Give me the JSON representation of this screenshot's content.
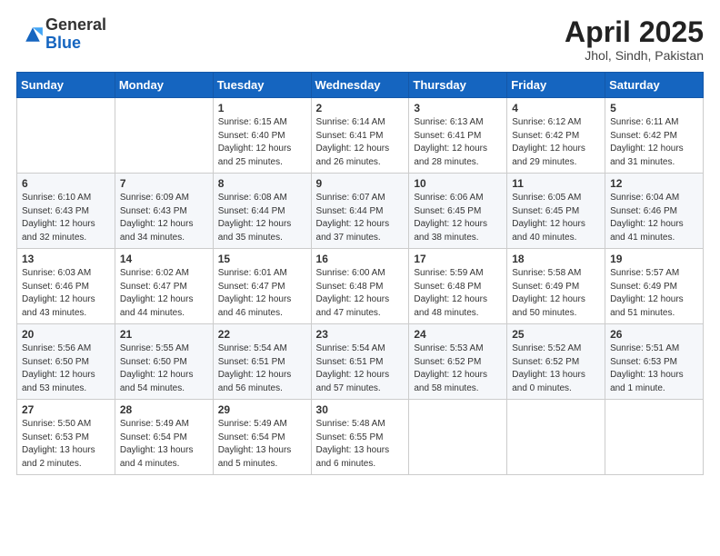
{
  "header": {
    "logo": {
      "line1": "General",
      "line2": "Blue"
    },
    "title": "April 2025",
    "subtitle": "Jhol, Sindh, Pakistan"
  },
  "weekdays": [
    "Sunday",
    "Monday",
    "Tuesday",
    "Wednesday",
    "Thursday",
    "Friday",
    "Saturday"
  ],
  "weeks": [
    [
      {
        "day": null
      },
      {
        "day": null
      },
      {
        "day": "1",
        "sunrise": "6:15 AM",
        "sunset": "6:40 PM",
        "daylight": "12 hours and 25 minutes."
      },
      {
        "day": "2",
        "sunrise": "6:14 AM",
        "sunset": "6:41 PM",
        "daylight": "12 hours and 26 minutes."
      },
      {
        "day": "3",
        "sunrise": "6:13 AM",
        "sunset": "6:41 PM",
        "daylight": "12 hours and 28 minutes."
      },
      {
        "day": "4",
        "sunrise": "6:12 AM",
        "sunset": "6:42 PM",
        "daylight": "12 hours and 29 minutes."
      },
      {
        "day": "5",
        "sunrise": "6:11 AM",
        "sunset": "6:42 PM",
        "daylight": "12 hours and 31 minutes."
      }
    ],
    [
      {
        "day": "6",
        "sunrise": "6:10 AM",
        "sunset": "6:43 PM",
        "daylight": "12 hours and 32 minutes."
      },
      {
        "day": "7",
        "sunrise": "6:09 AM",
        "sunset": "6:43 PM",
        "daylight": "12 hours and 34 minutes."
      },
      {
        "day": "8",
        "sunrise": "6:08 AM",
        "sunset": "6:44 PM",
        "daylight": "12 hours and 35 minutes."
      },
      {
        "day": "9",
        "sunrise": "6:07 AM",
        "sunset": "6:44 PM",
        "daylight": "12 hours and 37 minutes."
      },
      {
        "day": "10",
        "sunrise": "6:06 AM",
        "sunset": "6:45 PM",
        "daylight": "12 hours and 38 minutes."
      },
      {
        "day": "11",
        "sunrise": "6:05 AM",
        "sunset": "6:45 PM",
        "daylight": "12 hours and 40 minutes."
      },
      {
        "day": "12",
        "sunrise": "6:04 AM",
        "sunset": "6:46 PM",
        "daylight": "12 hours and 41 minutes."
      }
    ],
    [
      {
        "day": "13",
        "sunrise": "6:03 AM",
        "sunset": "6:46 PM",
        "daylight": "12 hours and 43 minutes."
      },
      {
        "day": "14",
        "sunrise": "6:02 AM",
        "sunset": "6:47 PM",
        "daylight": "12 hours and 44 minutes."
      },
      {
        "day": "15",
        "sunrise": "6:01 AM",
        "sunset": "6:47 PM",
        "daylight": "12 hours and 46 minutes."
      },
      {
        "day": "16",
        "sunrise": "6:00 AM",
        "sunset": "6:48 PM",
        "daylight": "12 hours and 47 minutes."
      },
      {
        "day": "17",
        "sunrise": "5:59 AM",
        "sunset": "6:48 PM",
        "daylight": "12 hours and 48 minutes."
      },
      {
        "day": "18",
        "sunrise": "5:58 AM",
        "sunset": "6:49 PM",
        "daylight": "12 hours and 50 minutes."
      },
      {
        "day": "19",
        "sunrise": "5:57 AM",
        "sunset": "6:49 PM",
        "daylight": "12 hours and 51 minutes."
      }
    ],
    [
      {
        "day": "20",
        "sunrise": "5:56 AM",
        "sunset": "6:50 PM",
        "daylight": "12 hours and 53 minutes."
      },
      {
        "day": "21",
        "sunrise": "5:55 AM",
        "sunset": "6:50 PM",
        "daylight": "12 hours and 54 minutes."
      },
      {
        "day": "22",
        "sunrise": "5:54 AM",
        "sunset": "6:51 PM",
        "daylight": "12 hours and 56 minutes."
      },
      {
        "day": "23",
        "sunrise": "5:54 AM",
        "sunset": "6:51 PM",
        "daylight": "12 hours and 57 minutes."
      },
      {
        "day": "24",
        "sunrise": "5:53 AM",
        "sunset": "6:52 PM",
        "daylight": "12 hours and 58 minutes."
      },
      {
        "day": "25",
        "sunrise": "5:52 AM",
        "sunset": "6:52 PM",
        "daylight": "13 hours and 0 minutes."
      },
      {
        "day": "26",
        "sunrise": "5:51 AM",
        "sunset": "6:53 PM",
        "daylight": "13 hours and 1 minute."
      }
    ],
    [
      {
        "day": "27",
        "sunrise": "5:50 AM",
        "sunset": "6:53 PM",
        "daylight": "13 hours and 2 minutes."
      },
      {
        "day": "28",
        "sunrise": "5:49 AM",
        "sunset": "6:54 PM",
        "daylight": "13 hours and 4 minutes."
      },
      {
        "day": "29",
        "sunrise": "5:49 AM",
        "sunset": "6:54 PM",
        "daylight": "13 hours and 5 minutes."
      },
      {
        "day": "30",
        "sunrise": "5:48 AM",
        "sunset": "6:55 PM",
        "daylight": "13 hours and 6 minutes."
      },
      {
        "day": null
      },
      {
        "day": null
      },
      {
        "day": null
      }
    ]
  ],
  "labels": {
    "sunrise_prefix": "Sunrise: ",
    "sunset_prefix": "Sunset: ",
    "daylight_prefix": "Daylight: "
  }
}
